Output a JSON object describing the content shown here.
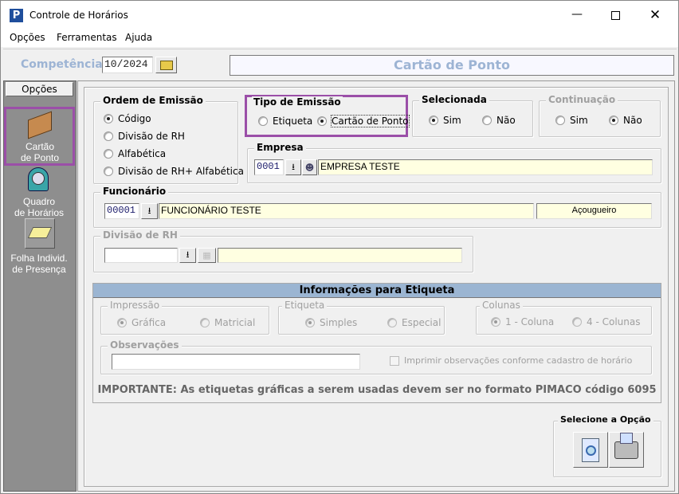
{
  "window": {
    "title": "Controle de Horários",
    "app_icon": "P"
  },
  "menu": [
    "Opções",
    "Ferramentas",
    "Ajuda"
  ],
  "toolbar": {
    "competencia_label": "Competência:",
    "competencia_value": "10/2024",
    "screen_title": "Cartão de Ponto"
  },
  "sidebar": {
    "header": "Opções",
    "items": [
      {
        "label1": "Cartão",
        "label2": "de Ponto",
        "icon": "card-box-icon"
      },
      {
        "label1": "Quadro",
        "label2": "de Horários",
        "icon": "clock-icon"
      },
      {
        "label1": "Folha Individ.",
        "label2": "de Presença",
        "icon": "papers-icon"
      }
    ]
  },
  "ordem": {
    "title": "Ordem de Emissão",
    "options": [
      "Código",
      "Divisão de RH",
      "Alfabética",
      "Divisão de RH+ Alfabética"
    ],
    "selected": 0
  },
  "tipo": {
    "title": "Tipo de Emissão",
    "options": [
      "Etiqueta",
      "Cartão de Ponto"
    ],
    "selected": 1
  },
  "selecionada": {
    "title": "Selecionada",
    "options": [
      "Sim",
      "Não"
    ],
    "selected": 0
  },
  "continuacao": {
    "title": "Continuação",
    "options": [
      "Sim",
      "Não"
    ],
    "selected": 1
  },
  "empresa": {
    "title": "Empresa",
    "code": "0001",
    "name": "EMPRESA TESTE"
  },
  "funcionario": {
    "title": "Funcionário",
    "code": "00001",
    "name": "FUNCIONÁRIO TESTE",
    "cargo": "Açougueiro"
  },
  "divisao": {
    "title": "Divisão de RH",
    "code": "",
    "name": ""
  },
  "etiqueta": {
    "header": "Informações para Etiqueta",
    "impressao": {
      "title": "Impressão",
      "options": [
        "Gráfica",
        "Matricial"
      ]
    },
    "etiqueta": {
      "title": "Etiqueta",
      "options": [
        "Simples",
        "Especial"
      ]
    },
    "colunas": {
      "title": "Colunas",
      "options": [
        "1 - Coluna",
        "4 - Colunas"
      ]
    },
    "observacoes": {
      "title": "Observações",
      "value": "",
      "checkbox": "Imprimir observações conforme cadastro de horário"
    },
    "importante": "IMPORTANTE: As etiquetas gráficas a serem usadas devem ser no formato PIMACO código 6095"
  },
  "acoes": {
    "title": "Selecione a Opção"
  },
  "colors": {
    "highlight": "#9b4fa8",
    "title_blue": "#9db4d4",
    "sidebar": "#8e8e8e"
  }
}
